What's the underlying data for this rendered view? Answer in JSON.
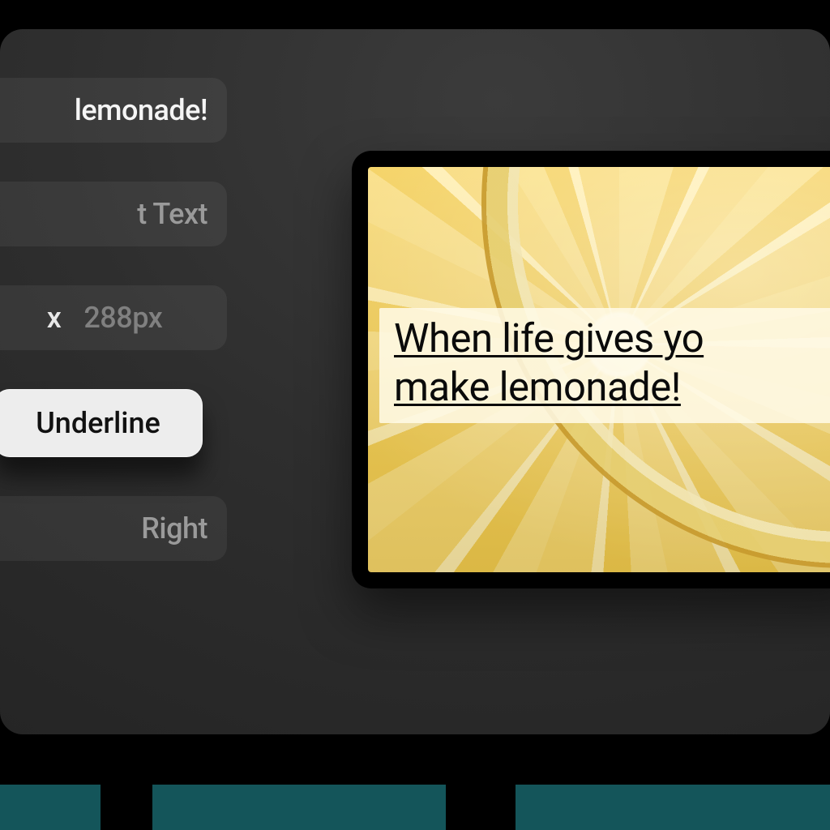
{
  "sidebar": {
    "text_value_suffix": "lemonade!",
    "placeholder_label": "t Text",
    "size_a": "x",
    "size_b": "288px",
    "underline_label": "Underline",
    "align_label": "Right"
  },
  "canvas": {
    "caption_line1": "When life gives yo",
    "caption_line2": "make lemonade!"
  },
  "colors": {
    "accent_teal": "#14555a",
    "panel_bg": "#2c2c2c",
    "button_active_bg": "#ededed"
  }
}
